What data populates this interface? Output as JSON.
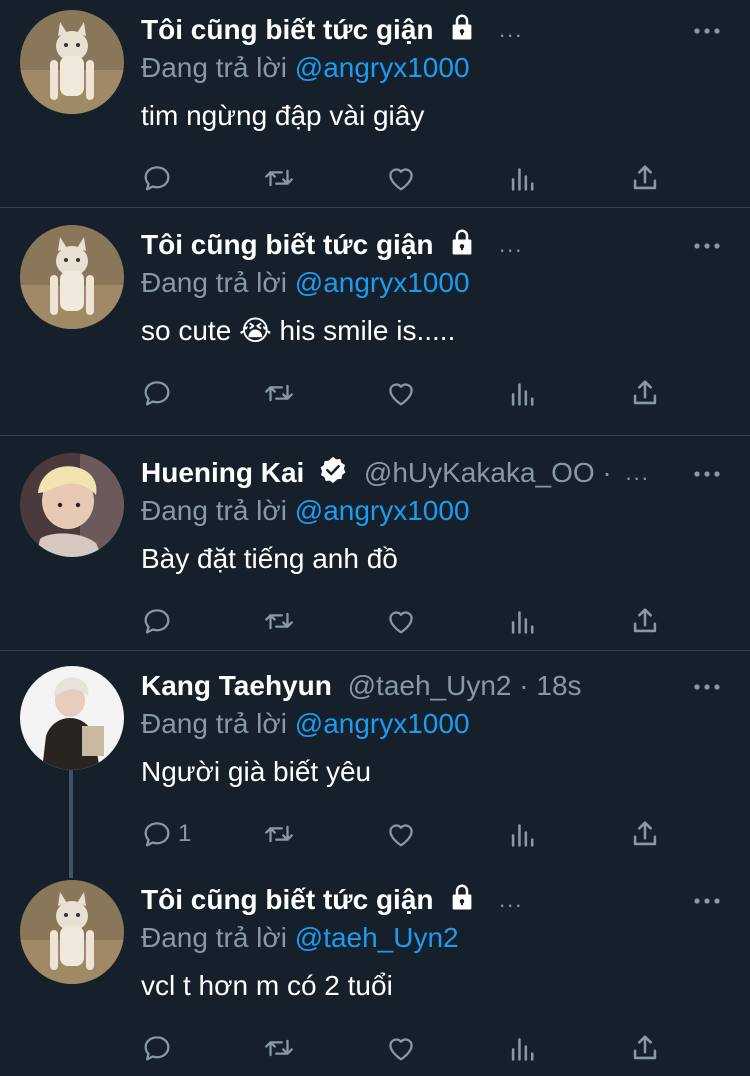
{
  "tweets": [
    {
      "name": "Tôi cũng biết tức giận",
      "handle": "",
      "time": "",
      "replying_prefix": "Đang trả lời",
      "replying_to": "@angryx1000",
      "text": "tim ngừng đập vài giây",
      "avatar": "cat",
      "reply_count": ""
    },
    {
      "name": "Tôi cũng biết tức giận",
      "handle": "",
      "time": "",
      "replying_prefix": "Đang trả lời",
      "replying_to": "@angryx1000",
      "text": "so cute 😭  his smile is.....",
      "avatar": "cat",
      "reply_count": ""
    },
    {
      "name": "Huening Kai",
      "handle": "@hUyKakaka_OO ·",
      "time": "",
      "replying_prefix": "Đang trả lời",
      "replying_to": "@angryx1000",
      "text": "Bày đặt tiếng anh đồ",
      "avatar": "person-blond",
      "reply_count": ""
    },
    {
      "name": "Kang Taehyun",
      "handle": "@taeh_Uyn2 · 18s",
      "time": "",
      "replying_prefix": "Đang trả lời",
      "replying_to": "@angryx1000",
      "text": "Người già biết yêu",
      "avatar": "person-white-bg",
      "reply_count": "1"
    },
    {
      "name": "Tôi cũng biết tức giận",
      "handle": "",
      "time": "",
      "replying_prefix": "Đang trả lời",
      "replying_to": "@taeh_Uyn2",
      "text": "vcl t hơn m có 2 tuổi",
      "avatar": "cat",
      "reply_count": ""
    }
  ],
  "ellipsis": "...",
  "colors": {
    "background": "#15202b",
    "secondary_text": "#8899a6",
    "link": "#1d9bf0",
    "divider": "#38444d"
  },
  "icons": [
    "reply-icon",
    "retweet-icon",
    "like-icon",
    "analytics-icon",
    "share-icon",
    "more-icon",
    "lock-icon",
    "verified-badge-icon"
  ]
}
